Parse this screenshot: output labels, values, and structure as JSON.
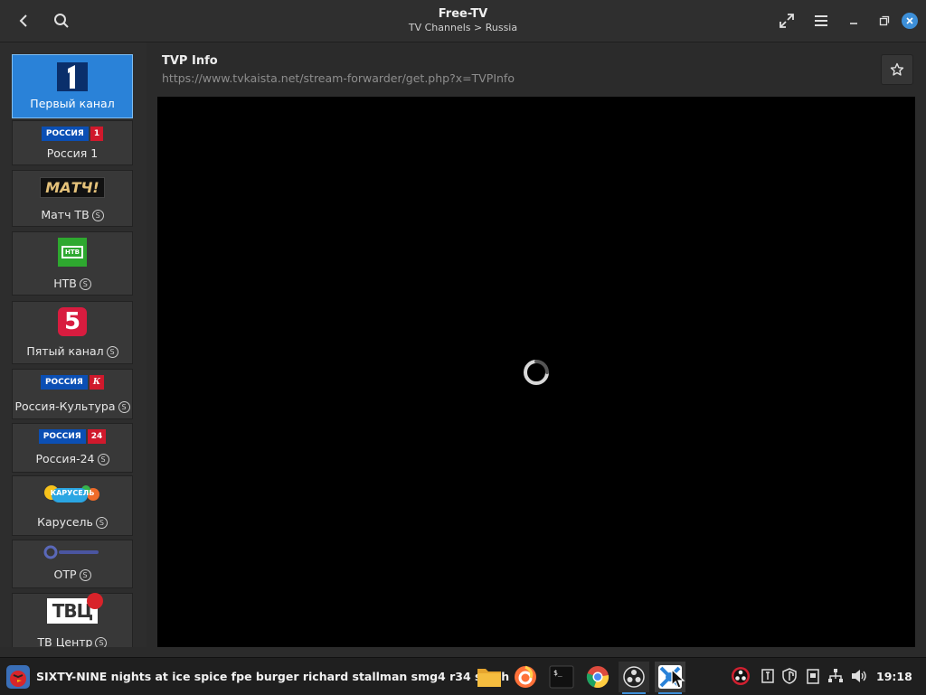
{
  "window": {
    "title": "Free-TV",
    "subtitle": "TV Channels > Russia",
    "accent": "#3d8fd8"
  },
  "header_icons": [
    "back-arrow-icon",
    "search-icon",
    "fullscreen-icon",
    "hamburger-menu-icon",
    "minimize-icon",
    "restore-icon",
    "close-icon"
  ],
  "channels": [
    {
      "name": "Первый канал",
      "logo": "1",
      "badge": "",
      "active": true
    },
    {
      "name": "Россия 1",
      "logo_text": "РОССИЯ",
      "logo_tag": "1",
      "badge": ""
    },
    {
      "name": "Матч ТВ",
      "logo_text": "МАТЧ!",
      "badge": "S"
    },
    {
      "name": "НТВ",
      "logo_text": "НТВ",
      "badge": "S"
    },
    {
      "name": "Пятый канал",
      "logo_text": "5",
      "badge": "S"
    },
    {
      "name": "Россия-Культура",
      "logo_text": "РОССИЯ",
      "logo_tag": "К",
      "badge": "S"
    },
    {
      "name": "Россия-24",
      "logo_text": "РОССИЯ",
      "logo_tag": "24",
      "badge": "S"
    },
    {
      "name": "Карусель",
      "logo_text": "КАРУСЕЛЬ",
      "badge": "S"
    },
    {
      "name": "ОТР",
      "badge": "S"
    },
    {
      "name": "ТВ Центр",
      "logo_text": "ТВЦ",
      "badge": "S"
    }
  ],
  "stream": {
    "title": "TVP Info",
    "url": "https://www.tvkaista.net/stream-forwarder/get.php?x=TVPInfo",
    "state": "loading"
  },
  "taskbar": {
    "now_playing": "SIXTY-NINE nights at ice spice fpe burger richard stallman smg4 r34 stash",
    "apps": [
      "files-icon",
      "firefox-icon",
      "terminal-icon",
      "chrome-icon",
      "obs-icon",
      "free-tv-icon"
    ],
    "tray": [
      "obs-tray-icon",
      "keyboard-layout-icon",
      "shield-icon",
      "clipboard-icon",
      "network-icon",
      "volume-icon"
    ],
    "clock": "19:18"
  }
}
